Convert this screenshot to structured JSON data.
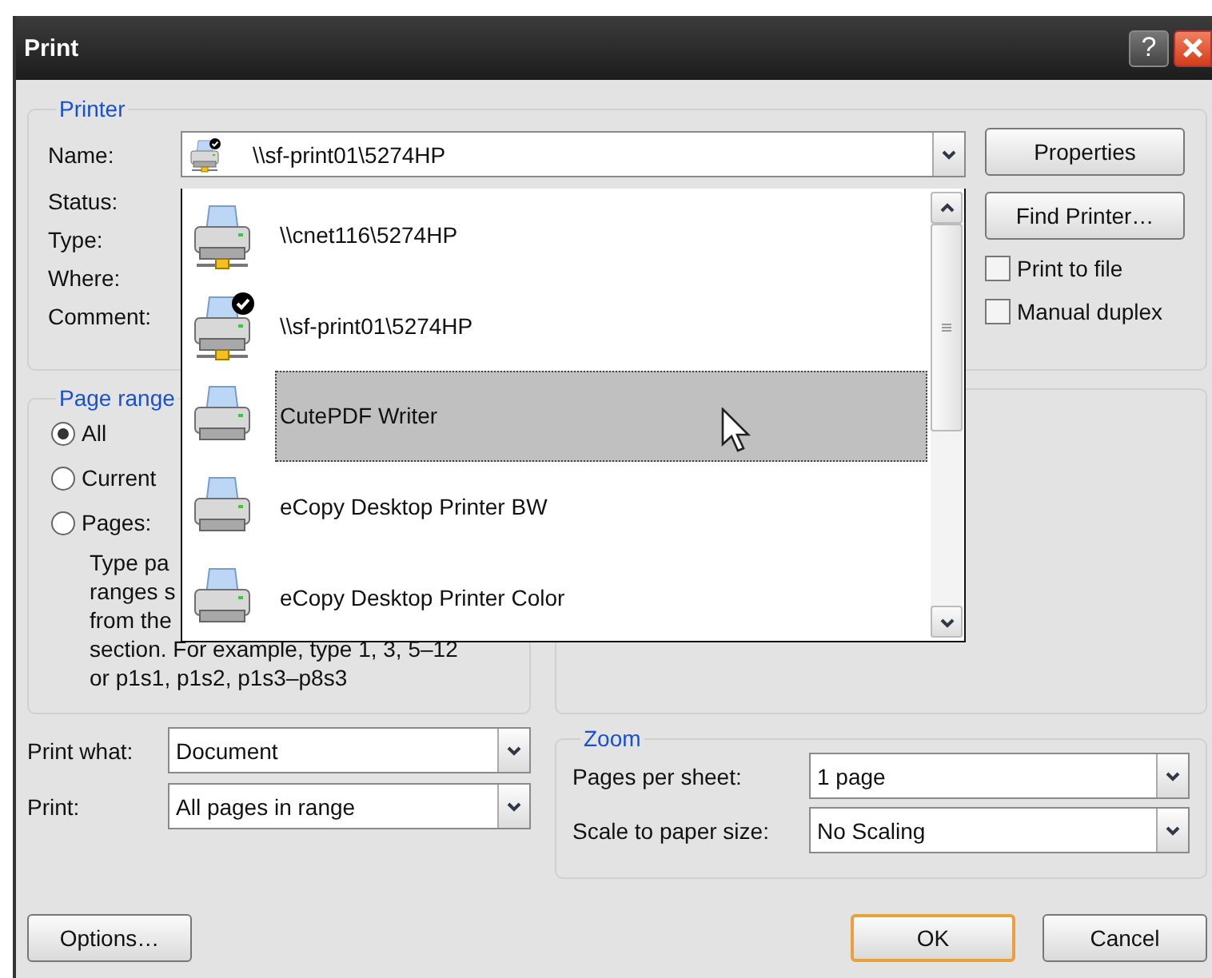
{
  "window": {
    "title": "Print",
    "help_button": "?"
  },
  "printer": {
    "legend": "Printer",
    "name_label": "Name:",
    "name_value": {
      "text": "\\\\sf-print01\\5274HP",
      "network": true,
      "default": true
    },
    "info_labels": [
      "Status:",
      "Type:",
      "Where:",
      "Comment:"
    ],
    "buttons": [
      "Properties",
      "Find Printer…"
    ],
    "options": [
      {
        "label": "Print to file",
        "checked": false
      },
      {
        "label": "Manual duplex",
        "checked": false
      }
    ]
  },
  "printer_list": [
    {
      "name": "\\\\cnet116\\5274HP",
      "network": true,
      "default": false,
      "selected": false
    },
    {
      "name": "\\\\sf-print01\\5274HP",
      "network": true,
      "default": true,
      "selected": false
    },
    {
      "name": "CutePDF Writer",
      "network": false,
      "default": false,
      "selected": true
    },
    {
      "name": "eCopy Desktop Printer BW",
      "network": false,
      "default": false,
      "selected": false
    },
    {
      "name": "eCopy Desktop Printer Color",
      "network": false,
      "default": false,
      "selected": false
    }
  ],
  "page_range": {
    "legend": "Page range",
    "options": [
      {
        "label": "All",
        "selected": true
      },
      {
        "label": "Current",
        "selected": false
      },
      {
        "label": "Pages:",
        "selected": false
      }
    ],
    "hint_lines": [
      "Type pa",
      "ranges s",
      "from the",
      "section. For example, type 1, 3, 5–12",
      "or p1s1, p1s2, p1s3–p8s3"
    ]
  },
  "print_what": {
    "label": "Print what:",
    "value": "Document"
  },
  "print": {
    "label": "Print:",
    "value": "All pages in range"
  },
  "zoom": {
    "legend": "Zoom",
    "rows": [
      {
        "label": "Pages per sheet:",
        "value": "1 page"
      },
      {
        "label": "Scale to paper size:",
        "value": "No Scaling"
      }
    ]
  },
  "footer": {
    "left_buttons": [
      {
        "label": "Options…",
        "default": false
      }
    ],
    "right_buttons": [
      {
        "label": "OK",
        "default": true
      },
      {
        "label": "Cancel",
        "default": false
      }
    ]
  }
}
